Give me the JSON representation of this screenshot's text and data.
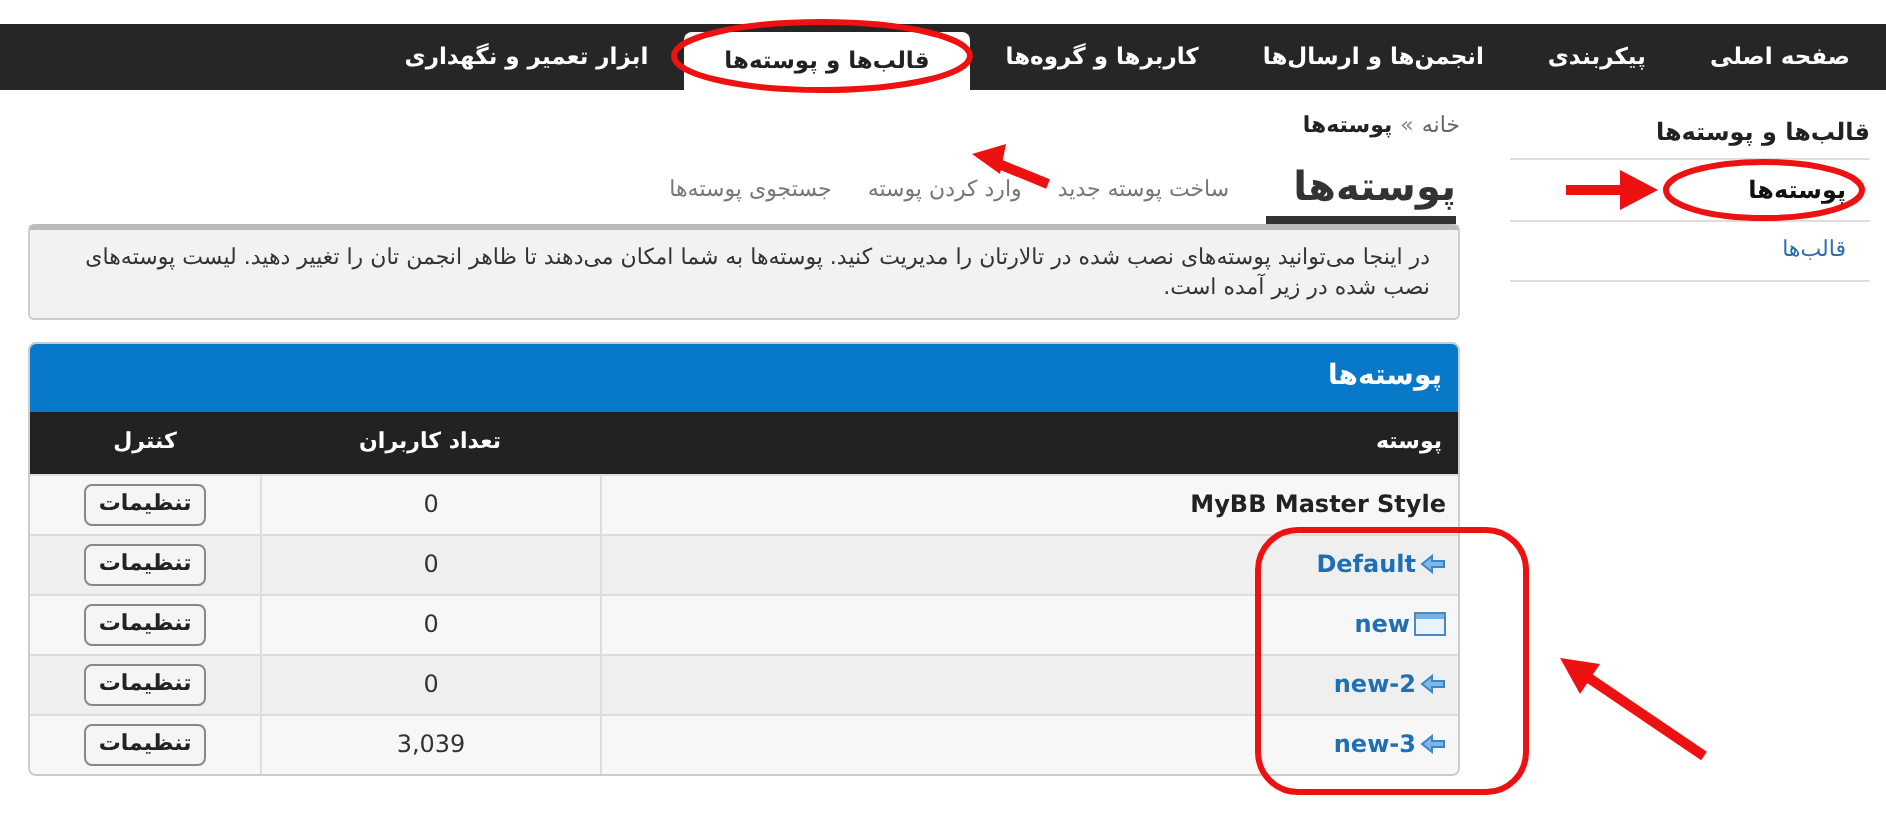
{
  "nav": [
    {
      "label": "صفحه اصلی",
      "selected": false
    },
    {
      "label": "پیکربندی",
      "selected": false
    },
    {
      "label": "انجمن‌ها و ارسال‌ها",
      "selected": false
    },
    {
      "label": "کاربرها و گروه‌ها",
      "selected": false
    },
    {
      "label": "قالب‌ها و پوسته‌ها",
      "selected": true
    },
    {
      "label": "ابزار تعمیر و نگهداری",
      "selected": false
    }
  ],
  "sidebar": {
    "title": "قالب‌ها و پوسته‌ها",
    "items": [
      {
        "label": "پوسته‌ها",
        "selected": true
      },
      {
        "label": "قالب‌ها",
        "selected": false
      }
    ]
  },
  "breadcrumb": {
    "home": "خانه",
    "separator": "»",
    "current": "پوسته‌ها"
  },
  "tabs": [
    {
      "label": "پوسته‌ها",
      "selected": true
    },
    {
      "label": "ساخت پوسته جدید",
      "selected": false
    },
    {
      "label": "وارد کردن پوسته",
      "selected": false
    },
    {
      "label": "جستجوی پوسته‌ها",
      "selected": false
    }
  ],
  "description": "در اینجا می‌توانید پوسته‌های نصب شده در تالارتان را مدیریت کنید. پوسته‌ها به شما امکان می‌دهند تا ظاهر انجمن تان را تغییر دهید. لیست پوسته‌های نصب شده در زیر آمده است.",
  "table": {
    "title": "پوسته‌ها",
    "columns": [
      "پوسته",
      "تعداد کاربران",
      "کنترل"
    ],
    "rows": [
      {
        "name": "MyBB Master Style",
        "kind": "master",
        "users": "0",
        "button": "تنظیمات"
      },
      {
        "name": "Default",
        "kind": "child",
        "users": "0",
        "button": "تنظیمات"
      },
      {
        "name": "new",
        "kind": "default",
        "users": "0",
        "button": "تنظیمات"
      },
      {
        "name": "new-2",
        "kind": "child",
        "users": "0",
        "button": "تنظیمات"
      },
      {
        "name": "new-3",
        "kind": "child",
        "users": "3,039",
        "button": "تنظیمات"
      }
    ]
  }
}
